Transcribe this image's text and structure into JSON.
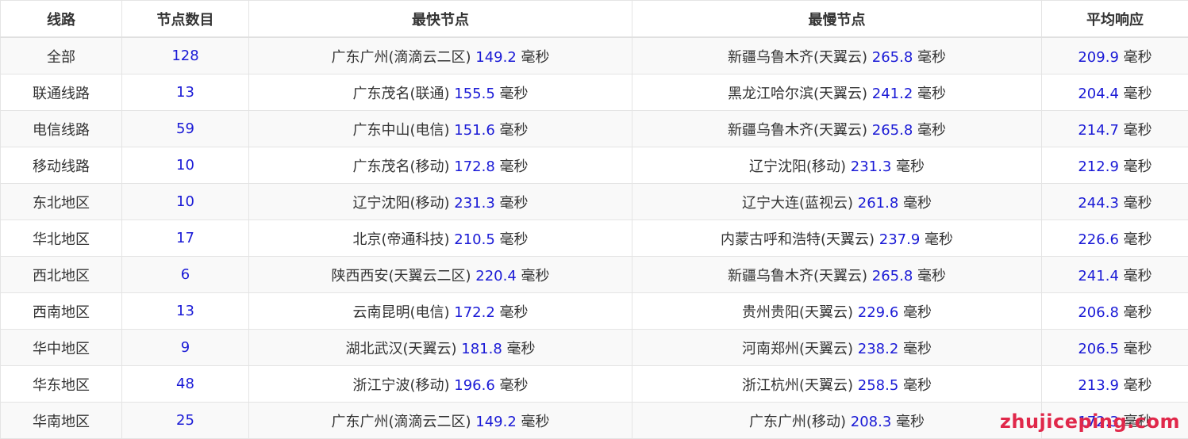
{
  "headers": [
    "线路",
    "节点数目",
    "最快节点",
    "最慢节点",
    "平均响应"
  ],
  "unit": "毫秒",
  "rows": [
    {
      "line": "全部",
      "count": "128",
      "fast_name": "广东广州(滴滴云二区)",
      "fast_ms": "149.2",
      "slow_name": "新疆乌鲁木齐(天翼云)",
      "slow_ms": "265.8",
      "avg_ms": "209.9"
    },
    {
      "line": "联通线路",
      "count": "13",
      "fast_name": "广东茂名(联通)",
      "fast_ms": "155.5",
      "slow_name": "黑龙江哈尔滨(天翼云)",
      "slow_ms": "241.2",
      "avg_ms": "204.4"
    },
    {
      "line": "电信线路",
      "count": "59",
      "fast_name": "广东中山(电信)",
      "fast_ms": "151.6",
      "slow_name": "新疆乌鲁木齐(天翼云)",
      "slow_ms": "265.8",
      "avg_ms": "214.7"
    },
    {
      "line": "移动线路",
      "count": "10",
      "fast_name": "广东茂名(移动)",
      "fast_ms": "172.8",
      "slow_name": "辽宁沈阳(移动)",
      "slow_ms": "231.3",
      "avg_ms": "212.9"
    },
    {
      "line": "东北地区",
      "count": "10",
      "fast_name": "辽宁沈阳(移动)",
      "fast_ms": "231.3",
      "slow_name": "辽宁大连(蓝视云)",
      "slow_ms": "261.8",
      "avg_ms": "244.3"
    },
    {
      "line": "华北地区",
      "count": "17",
      "fast_name": "北京(帝通科技)",
      "fast_ms": "210.5",
      "slow_name": "内蒙古呼和浩特(天翼云)",
      "slow_ms": "237.9",
      "avg_ms": "226.6"
    },
    {
      "line": "西北地区",
      "count": "6",
      "fast_name": "陕西西安(天翼云二区)",
      "fast_ms": "220.4",
      "slow_name": "新疆乌鲁木齐(天翼云)",
      "slow_ms": "265.8",
      "avg_ms": "241.4"
    },
    {
      "line": "西南地区",
      "count": "13",
      "fast_name": "云南昆明(电信)",
      "fast_ms": "172.2",
      "slow_name": "贵州贵阳(天翼云)",
      "slow_ms": "229.6",
      "avg_ms": "206.8"
    },
    {
      "line": "华中地区",
      "count": "9",
      "fast_name": "湖北武汉(天翼云)",
      "fast_ms": "181.8",
      "slow_name": "河南郑州(天翼云)",
      "slow_ms": "238.2",
      "avg_ms": "206.5"
    },
    {
      "line": "华东地区",
      "count": "48",
      "fast_name": "浙江宁波(移动)",
      "fast_ms": "196.6",
      "slow_name": "浙江杭州(天翼云)",
      "slow_ms": "258.5",
      "avg_ms": "213.9"
    },
    {
      "line": "华南地区",
      "count": "25",
      "fast_name": "广东广州(滴滴云二区)",
      "fast_ms": "149.2",
      "slow_name": "广东广州(移动)",
      "slow_ms": "208.3",
      "avg_ms": "172.3"
    }
  ],
  "watermark": "zhujiceping.com",
  "colors": {
    "number": "#1a1ad6",
    "text": "#333333",
    "watermark": "#e0284a"
  }
}
